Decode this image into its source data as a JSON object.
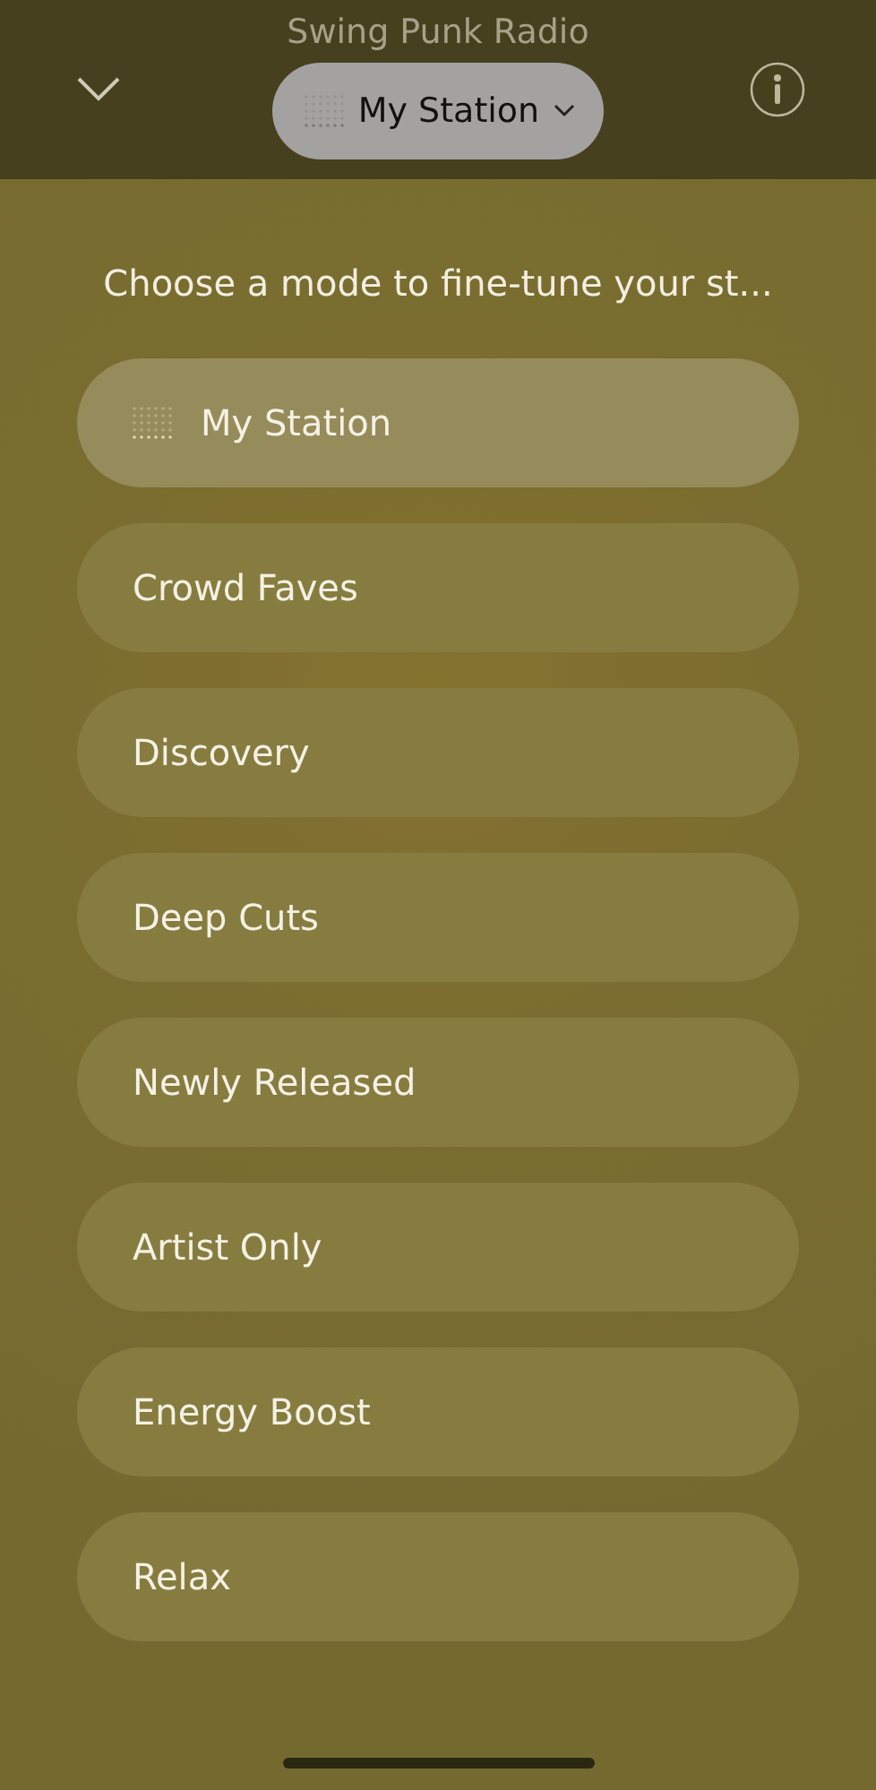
{
  "header": {
    "title": "Swing Punk Radio",
    "station": "My Station"
  },
  "prompt": "Choose a mode to fine-tune your st...",
  "modes": [
    {
      "label": "My Station",
      "selected": true
    },
    {
      "label": "Crowd Faves",
      "selected": false
    },
    {
      "label": "Discovery",
      "selected": false
    },
    {
      "label": "Deep Cuts",
      "selected": false
    },
    {
      "label": "Newly Released",
      "selected": false
    },
    {
      "label": "Artist Only",
      "selected": false
    },
    {
      "label": "Energy Boost",
      "selected": false
    },
    {
      "label": "Relax",
      "selected": false
    }
  ]
}
